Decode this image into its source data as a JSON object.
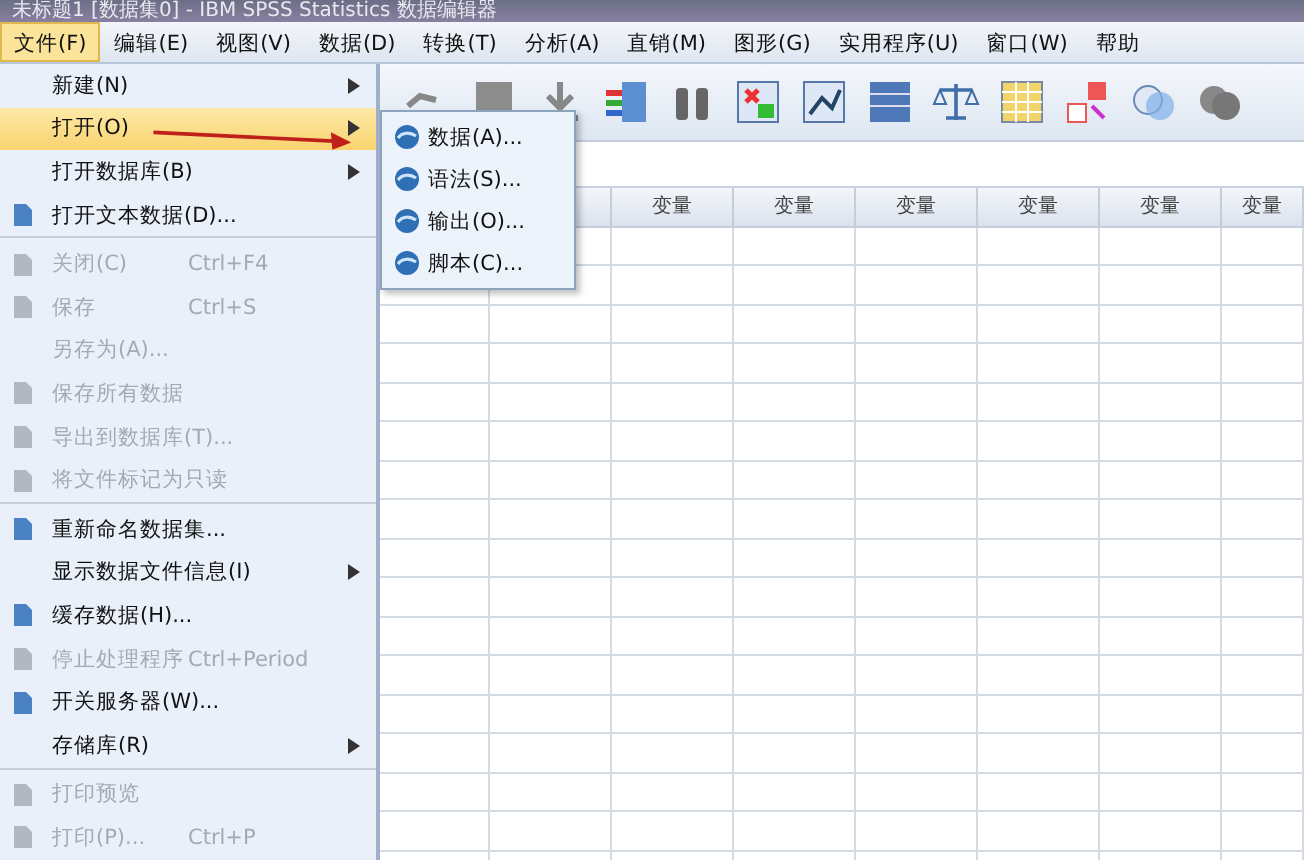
{
  "window": {
    "title": "未标题1 [数据集0] - IBM SPSS Statistics 数据编辑器"
  },
  "menubar": [
    {
      "label": "文件(F)",
      "selected": true
    },
    {
      "label": "编辑(E)",
      "selected": false
    },
    {
      "label": "视图(V)",
      "selected": false
    },
    {
      "label": "数据(D)",
      "selected": false
    },
    {
      "label": "转换(T)",
      "selected": false
    },
    {
      "label": "分析(A)",
      "selected": false
    },
    {
      "label": "直销(M)",
      "selected": false
    },
    {
      "label": "图形(G)",
      "selected": false
    },
    {
      "label": "实用程序(U)",
      "selected": false
    },
    {
      "label": "窗口(W)",
      "selected": false
    },
    {
      "label": "帮助",
      "selected": false
    }
  ],
  "file_menu": [
    {
      "label": "新建(N)",
      "has_icon": false,
      "submenu": true,
      "disabled": false,
      "selected": false
    },
    {
      "label": "打开(O)",
      "has_icon": false,
      "submenu": true,
      "disabled": false,
      "selected": true
    },
    {
      "label": "打开数据库(B)",
      "has_icon": false,
      "submenu": true,
      "disabled": false,
      "selected": false
    },
    {
      "label": "打开文本数据(D)...",
      "has_icon": true,
      "submenu": false,
      "disabled": false,
      "selected": false,
      "separator_after": true
    },
    {
      "label": "关闭(C)",
      "shortcut": "Ctrl+F4",
      "has_icon": true,
      "submenu": false,
      "disabled": true,
      "selected": false
    },
    {
      "label": "保存",
      "shortcut": "Ctrl+S",
      "has_icon": true,
      "submenu": false,
      "disabled": true,
      "selected": false
    },
    {
      "label": "另存为(A)...",
      "has_icon": false,
      "submenu": false,
      "disabled": true,
      "selected": false
    },
    {
      "label": "保存所有数据",
      "has_icon": true,
      "submenu": false,
      "disabled": true,
      "selected": false
    },
    {
      "label": "导出到数据库(T)...",
      "has_icon": true,
      "submenu": false,
      "disabled": true,
      "selected": false
    },
    {
      "label": "将文件标记为只读",
      "has_icon": true,
      "submenu": false,
      "disabled": true,
      "selected": false,
      "separator_after": true
    },
    {
      "label": "重新命名数据集...",
      "has_icon": true,
      "submenu": false,
      "disabled": false,
      "selected": false
    },
    {
      "label": "显示数据文件信息(I)",
      "has_icon": false,
      "submenu": true,
      "disabled": false,
      "selected": false
    },
    {
      "label": "缓存数据(H)...",
      "has_icon": true,
      "submenu": false,
      "disabled": false,
      "selected": false
    },
    {
      "label": "停止处理程序",
      "shortcut": "Ctrl+Period",
      "has_icon": true,
      "submenu": false,
      "disabled": true,
      "selected": false
    },
    {
      "label": "开关服务器(W)...",
      "has_icon": true,
      "submenu": false,
      "disabled": false,
      "selected": false
    },
    {
      "label": "存储库(R)",
      "has_icon": false,
      "submenu": true,
      "disabled": false,
      "selected": false,
      "separator_after": true
    },
    {
      "label": "打印预览",
      "has_icon": true,
      "submenu": false,
      "disabled": true,
      "selected": false
    },
    {
      "label": "打印(P)...",
      "shortcut": "Ctrl+P",
      "has_icon": true,
      "submenu": false,
      "disabled": true,
      "selected": false
    }
  ],
  "open_submenu": [
    {
      "label": "数据(A)..."
    },
    {
      "label": "语法(S)..."
    },
    {
      "label": "输出(O)..."
    },
    {
      "label": "脚本(C)..."
    }
  ],
  "grid": {
    "columns": [
      "变量",
      "变量",
      "变量",
      "变量",
      "变量",
      "变量"
    ]
  }
}
